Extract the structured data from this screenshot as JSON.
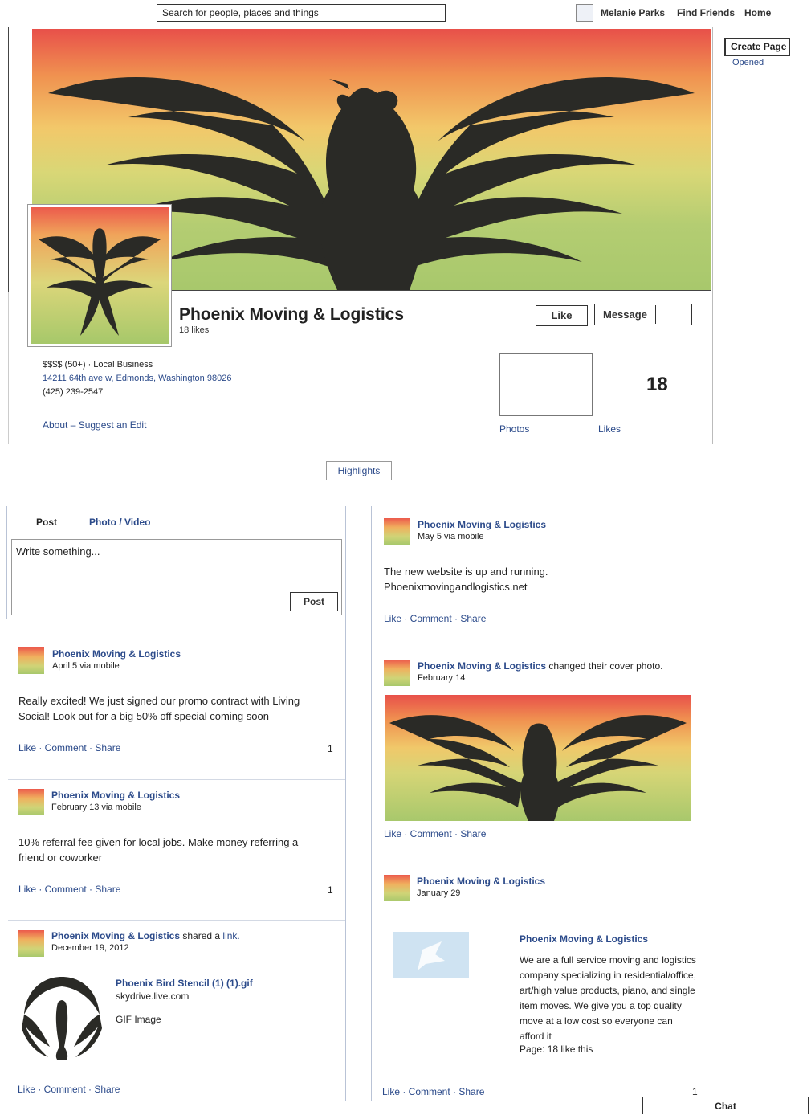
{
  "topbar": {
    "search_placeholder": "Search for people, places and things",
    "user_name": "Melanie Parks",
    "find_friends": "Find Friends",
    "home": "Home"
  },
  "rail": {
    "create_page": "Create Page",
    "opened": "Opened"
  },
  "page": {
    "name": "Phoenix Moving & Logistics",
    "likes_text": "18 likes",
    "like_button": "Like",
    "message_button": "Message",
    "price_category": "$$$$ (50+) · Local Business",
    "address": "14211 64th ave w, Edmonds, Washington 98026",
    "phone": "(425) 239-2547",
    "about_links": "About – Suggest an Edit",
    "photos_label": "Photos",
    "likes_count": "18",
    "likes_label": "Likes",
    "highlights": "Highlights"
  },
  "composer": {
    "tab_post": "Post",
    "tab_photo_video": "Photo / Video",
    "placeholder": "Write something...",
    "post_button": "Post"
  },
  "actions_label": "Like · Comment · Share",
  "left_posts": [
    {
      "author": "Phoenix Moving & Logistics",
      "meta": "April 5 via mobile",
      "text": "Really excited! We just signed our promo contract with Living Social! Look out for a big 50% off special coming soon",
      "count": "1"
    },
    {
      "author": "Phoenix Moving & Logistics",
      "meta": "February 13 via mobile",
      "text": "10% referral fee given for local jobs. Make money referring a friend or coworker",
      "count": "1"
    },
    {
      "author": "Phoenix Moving & Logistics",
      "suffix": "shared a",
      "suffix_link": "link.",
      "meta": "December 19, 2012",
      "link_title": "Phoenix Bird Stencil (1) (1).gif",
      "link_domain": "skydrive.live.com",
      "link_type": "GIF Image"
    }
  ],
  "right_posts": [
    {
      "author": "Phoenix Moving & Logistics",
      "meta": "May 5 via mobile",
      "text_line1": "The new website is up and running.",
      "text_line2": "Phoenixmovingandlogistics.net"
    },
    {
      "author": "Phoenix Moving & Logistics",
      "suffix": "changed their cover photo.",
      "meta": "February 14"
    },
    {
      "author": "Phoenix Moving & Logistics",
      "meta": "January 29",
      "share_title": "Phoenix Moving & Logistics",
      "share_desc": "We are a full service moving and logistics company specializing in residential/office, art/high value products, piano, and single item moves. We give you a top quality move at a low cost so everyone can afford it",
      "share_page": "Page: 18 like this",
      "count": "1"
    }
  ],
  "chat": "Chat"
}
